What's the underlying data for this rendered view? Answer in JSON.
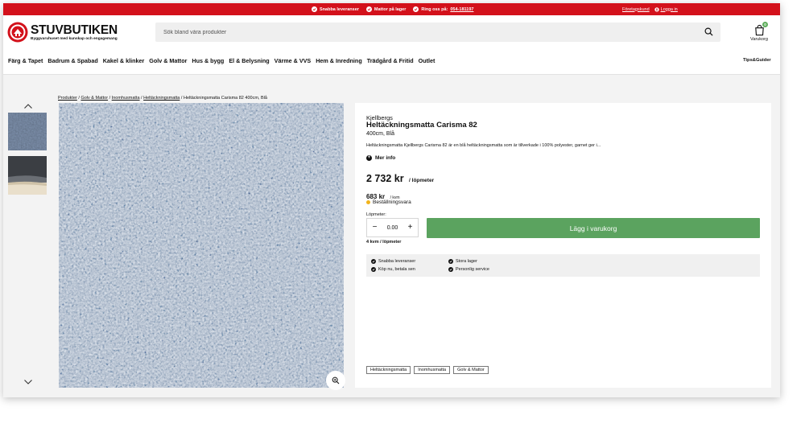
{
  "topbar": {
    "usps": [
      "Snabba leveranser",
      "Mattor på lager",
      "Ring oss på:"
    ],
    "phone": "054-181197",
    "company_account": "Företagskund",
    "login": "Logga in"
  },
  "header": {
    "brand_name": "STUVBUTIKEN",
    "brand_tagline": "Byggvaruhuset med kunskap och engagemang",
    "search_placeholder": "Sök bland våra produkter",
    "cart_label": "Varukorg",
    "cart_count": "0"
  },
  "nav": {
    "items": [
      "Färg & Tapet",
      "Badrum & Spabad",
      "Kakel & klinker",
      "Golv & Mattor",
      "Hus & bygg",
      "El & Belysning",
      "Värme & VVS",
      "Hem & Inredning",
      "Trädgård & Fritid",
      "Outlet"
    ],
    "tips": "Tips&Guider"
  },
  "breadcrumb": {
    "items": [
      "Produkter",
      "Golv & Mattor",
      "Inomhusmatta",
      "Heltäckningsmatta"
    ],
    "current": "Heltäckningsmatta Carisma 82 400cm, Blå"
  },
  "product": {
    "brand": "Kjellbergs",
    "title": "Heltäckningsmatta Carisma 82",
    "subtitle": "400cm, Blå",
    "description": "Heltäckningsmatta Kjellbergs Carisma 82 är en blå heltäckningsmatta som är tillverkade i 100% polyester, garnet ger i...",
    "more_info": "Mer info",
    "price": "2 732 kr",
    "price_unit": "/ löpmeter",
    "price_per_kvm": "683 kr",
    "price_per_kvm_unit": "/ kvm",
    "stock_status": "Beställningsvara",
    "quantity_label": "Löpmeter:",
    "quantity_value": "0.00",
    "add_to_cart": "Lägg i varukorg",
    "per_meter_note": "4 kvm / löpmeter",
    "usps": [
      "Snabba leveranser",
      "Köp nu, betala sen",
      "Stora lager",
      "Personlig service"
    ],
    "tags": [
      "Heltäckningsmatta",
      "Inomhusmatta",
      "Golv & Mattor"
    ]
  },
  "colors": {
    "topbar_red": "#d3111b",
    "cart_green": "#5ba35f",
    "stock_yellow": "#f2b41c",
    "carpet_blue": "#5d6b80"
  }
}
